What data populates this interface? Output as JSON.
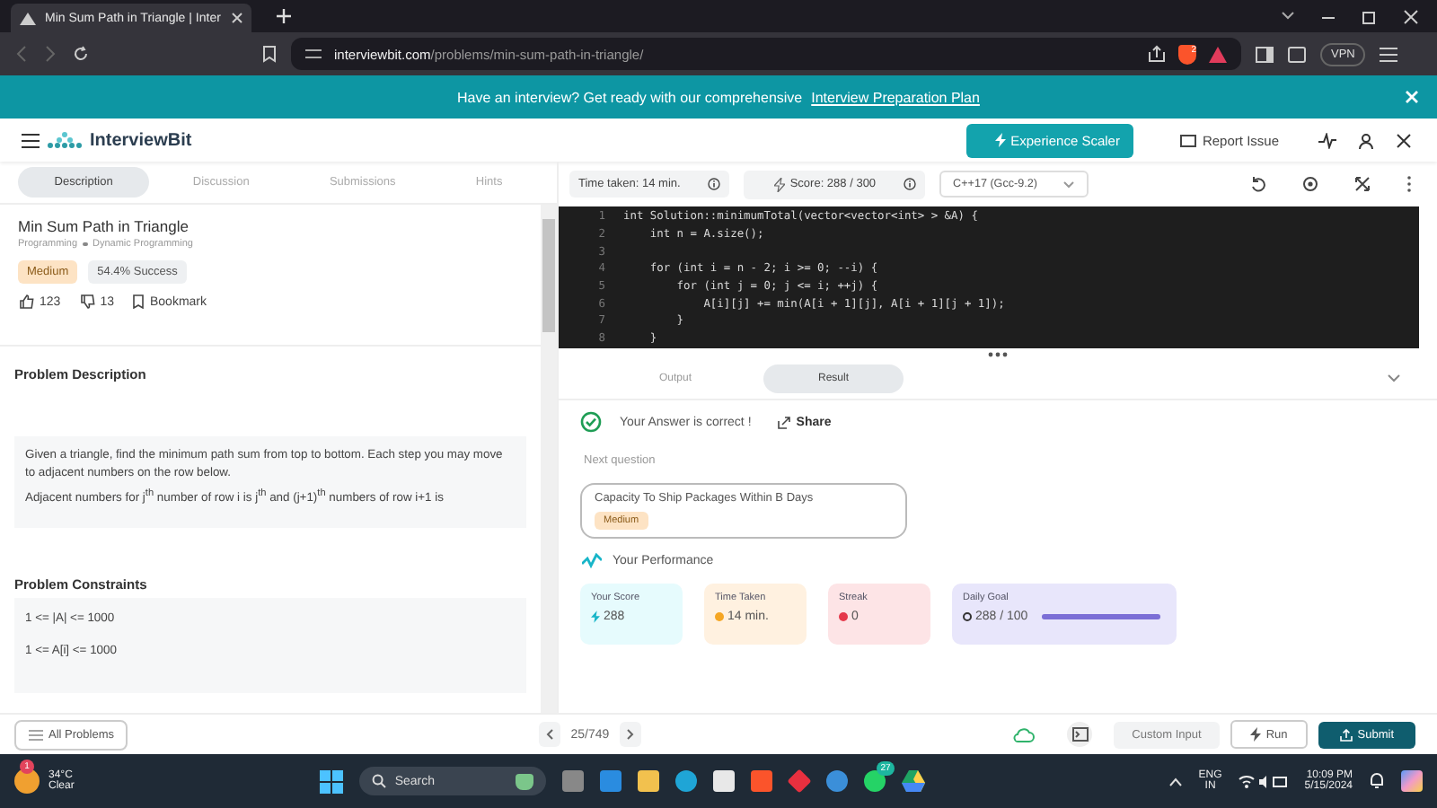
{
  "browser": {
    "tab_title": "Min Sum Path in Triangle | Inter",
    "url_domain": "interviewbit.com",
    "url_path": "/problems/min-sum-path-in-triangle/",
    "vpn": "VPN",
    "shield_badge": "2"
  },
  "banner": {
    "text": "Have an interview? Get ready with our comprehensive",
    "link": "Interview Preparation Plan"
  },
  "header": {
    "logo": "InterviewBit",
    "cta": "Experience Scaler",
    "report": "Report Issue"
  },
  "left_tabs": [
    {
      "label": "Description",
      "selected": true
    },
    {
      "label": "Discussion",
      "selected": false
    },
    {
      "label": "Submissions",
      "selected": false
    },
    {
      "label": "Hints",
      "selected": false
    }
  ],
  "problem": {
    "title": "Min Sum Path in Triangle",
    "breadcrumb": [
      "Programming",
      "Dynamic Programming"
    ],
    "difficulty": "Medium",
    "success": "54.4% Success",
    "likes": "123",
    "dislikes": "13",
    "bookmark": "Bookmark"
  },
  "description": {
    "heading": "Problem Description",
    "paragraphs": [
      "Given a triangle, find the minimum path sum from top to bottom. Each step you may move to adjacent numbers on the row below.",
      "Adjacent numbers for j$^{th}$ number of row i is j$^{th}$ and (j+1)$^{th}$ numbers of row i+1 is"
    ]
  },
  "constraints": {
    "heading": "Problem Constraints",
    "lines": [
      "1 <= |A| <= 1000",
      "1 <= A[i] <= 1000"
    ]
  },
  "editor_toolbar": {
    "time": "Time taken: 14 min.",
    "score": "Score: 288 / 300",
    "language": "C++17 (Gcc-9.2)"
  },
  "code": [
    {
      "number": "1",
      "text": "int Solution::minimumTotal(vector<vector<int> > &A) {"
    },
    {
      "number": "2",
      "text": "    int n = A.size();"
    },
    {
      "number": "3"
    },
    {
      "number": "4",
      "text": "    for (int i = n - 2; i >= 0; --i) {"
    },
    {
      "number": "5",
      "text": "        for (int j = 0; j <= i; ++j) {"
    },
    {
      "number": "6",
      "text": "            A[i][j] += min(A[i + 1][j], A[i + 1][j + 1]);"
    },
    {
      "number": "7",
      "text": "        }"
    },
    {
      "number": "8",
      "text": "    }"
    }
  ],
  "output_tabs": [
    {
      "label": "Output",
      "selected": false
    },
    {
      "label": "Result",
      "selected": true
    }
  ],
  "result": {
    "message": "Your Answer is correct !",
    "share": "Share",
    "next_label": "Next question",
    "next_title": "Capacity To Ship Packages Within B Days",
    "next_difficulty": "Medium",
    "performance": "Your Performance"
  },
  "stats": [
    {
      "kind": "score",
      "label": "Your Score",
      "value": "288",
      "color": "#e6fbfd"
    },
    {
      "kind": "time",
      "label": "Time Taken",
      "value": "14 min.",
      "color": "#fff1e0"
    },
    {
      "kind": "streak",
      "label": "Streak",
      "value": "0",
      "color": "#fde4e6"
    },
    {
      "kind": "goal",
      "label": "Daily Goal",
      "value": "288 / 100",
      "color": "#e8e6fb",
      "level": 1
    }
  ],
  "bottom_bar": {
    "all_problems": "All Problems",
    "pager": "25/749",
    "custom_input": "Custom Input",
    "run": "Run",
    "submit": "Submit"
  },
  "taskbar": {
    "weather_badge": "1",
    "temperature": "34°C",
    "weather": "Clear",
    "search": "Search",
    "whatsapp_badge": "27",
    "lang": "ENG",
    "region": "IN",
    "time": "10:09 PM",
    "date": "5/15/2024"
  }
}
